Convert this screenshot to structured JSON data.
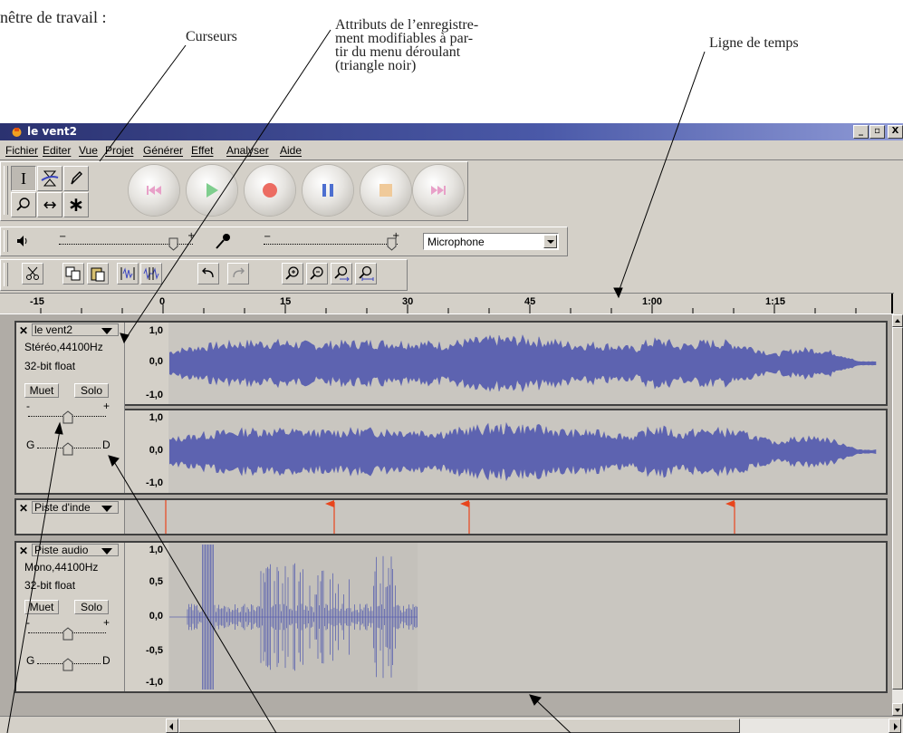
{
  "annotations": {
    "workspace": "nêtre de travail :",
    "cursors": "Curseurs",
    "attributes": [
      "Attributs de l’enregistre-",
      "ment modifiables à par-",
      "tir du menu déroulant",
      "(triangle noir)"
    ],
    "timeline": "Ligne de temps"
  },
  "window": {
    "title": "le vent2",
    "controls": {
      "minimize": "_",
      "maximize": "▫",
      "close": "X"
    }
  },
  "menu": [
    "Fichier",
    "Editer",
    "Vue",
    "Projet",
    "Générer",
    "Effet",
    "Analyser",
    "Aide"
  ],
  "tools": {
    "selection": "I",
    "envelope": "envelope-icon",
    "draw": "pencil-icon",
    "zoom": "magnifier-icon",
    "timeshift": "↔",
    "multi": "∗"
  },
  "transport": [
    "skip-start-icon",
    "play-icon",
    "record-icon",
    "pause-icon",
    "stop-icon",
    "skip-end-icon"
  ],
  "mixer": {
    "input_source": "Microphone",
    "output_volume": 0.85,
    "input_volume": 0.95
  },
  "ruler": {
    "labels": [
      "-15",
      "0",
      "15",
      "30",
      "45",
      "1:00",
      "1:15"
    ]
  },
  "tracks": {
    "stereo": {
      "name": "le vent2",
      "format": "Stéréo,44100Hz",
      "bit_depth": "32-bit float",
      "mute": "Muet",
      "solo": "Solo",
      "gain_minus": "-",
      "gain_plus": "+",
      "pan_left": "G",
      "pan_right": "D",
      "scale_top": [
        "1,0",
        "0,0",
        "-1,0"
      ],
      "scale_bottom": [
        "1,0",
        "0,0",
        "-1,0"
      ]
    },
    "label": {
      "name": "Piste d'inde"
    },
    "mono": {
      "name": "Piste audio",
      "format": "Mono,44100Hz",
      "bit_depth": "32-bit float",
      "mute": "Muet",
      "solo": "Solo",
      "gain_minus": "-",
      "gain_plus": "+",
      "pan_left": "G",
      "pan_right": "D",
      "scale": [
        "1,0",
        "0,5",
        "0,0",
        "-0,5",
        "-1,0"
      ]
    }
  },
  "colors": {
    "waveform": "#5d63b0",
    "title_bar": "#2b3270",
    "label_flag": "#e8451c"
  }
}
